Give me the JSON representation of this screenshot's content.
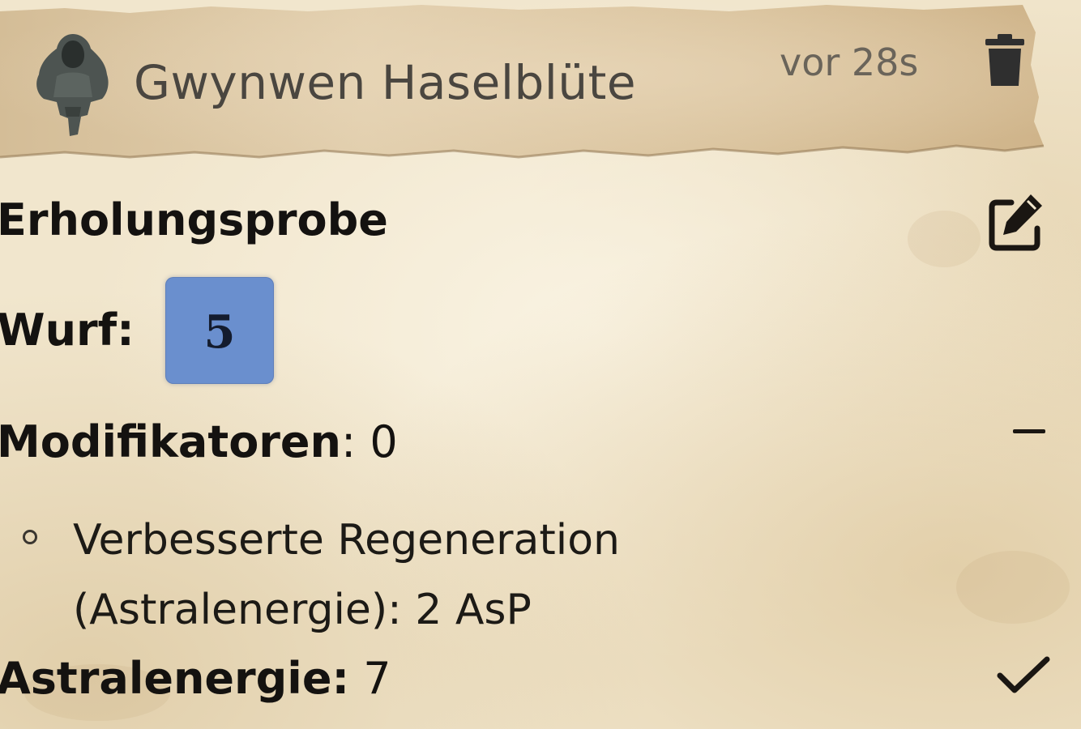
{
  "message": {
    "author": "Gwynwen Haselblüte",
    "timestamp": "vor 28s",
    "avatar_icon": "character-portrait-icon",
    "delete_icon": "trash-icon",
    "edit_icon": "edit-icon"
  },
  "roll": {
    "title": "Erholungsprobe",
    "roll_label": "Wurf:",
    "die_value": "5",
    "die_color": "#6a8fce",
    "modifiers_label": "Modifikatoren",
    "modifiers_value": "0",
    "modifiers_toggle_icon": "minus-icon",
    "modifiers": [
      {
        "line1": "Verbesserte Regeneration",
        "line2": "(Astralenergie): 2 AsP"
      }
    ],
    "result_label": "Astralenergie",
    "result_value": "7",
    "result_icon": "checkmark-icon"
  }
}
